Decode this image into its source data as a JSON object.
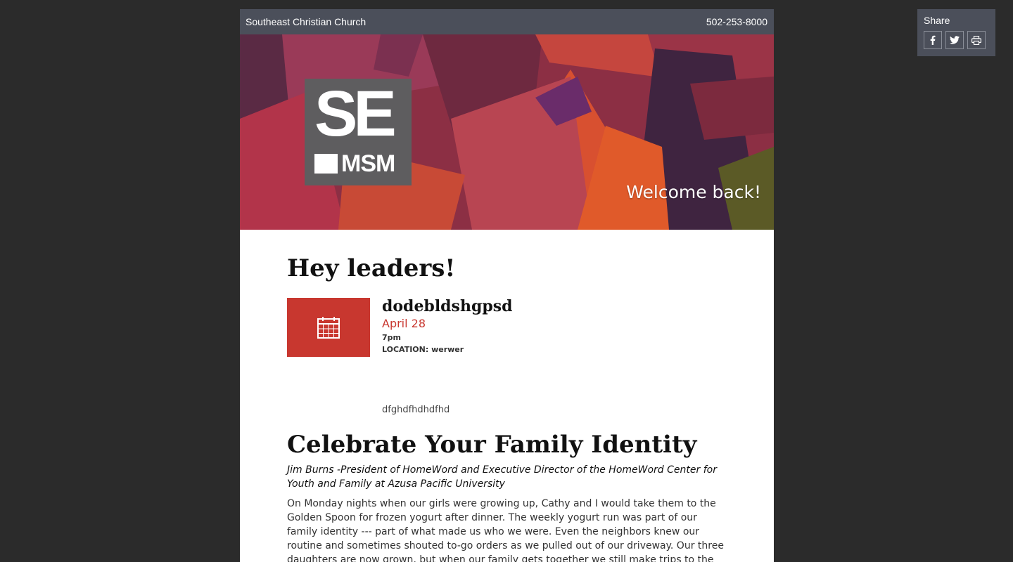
{
  "header": {
    "church_name": "Southeast Christian Church",
    "phone": "502-253-8000"
  },
  "hero": {
    "logo_top": "SE",
    "logo_bottom": "MSM",
    "welcome": "Welcome back!"
  },
  "greeting": "Hey leaders!",
  "event": {
    "icon": "calendar-icon",
    "title": "dodebldshgpsd",
    "date": "April 28",
    "time": "7pm",
    "location": "LOCATION: werwer",
    "description": "dfghdfhdhdfhd"
  },
  "article": {
    "title": "Celebrate Your Family Identity",
    "byline": "Jim Burns -President of HomeWord and Executive Director of the HomeWord Center for Youth and Family at Azusa Pacific University",
    "body": "On Monday nights when our girls were growing up, Cathy and I would take them to the Golden Spoon for frozen yogurt after dinner. The weekly yogurt run was part of our family identity --- part of what made us who we were. Even the neighbors knew our routine and sometimes shouted to-go orders as we pulled out of our driveway. Our three daughters are now grown, but when our family gets together we still make trips to the Golden Spoon. It's one of those simple traditions"
  },
  "share": {
    "label": "Share",
    "buttons": [
      {
        "icon": "facebook-icon"
      },
      {
        "icon": "twitter-icon"
      },
      {
        "icon": "print-icon"
      }
    ]
  },
  "colors": {
    "background": "#2b2b2b",
    "bar": "#4b4f5a",
    "accent_red": "#c8372f",
    "logo_gray": "#5e5d5f"
  }
}
